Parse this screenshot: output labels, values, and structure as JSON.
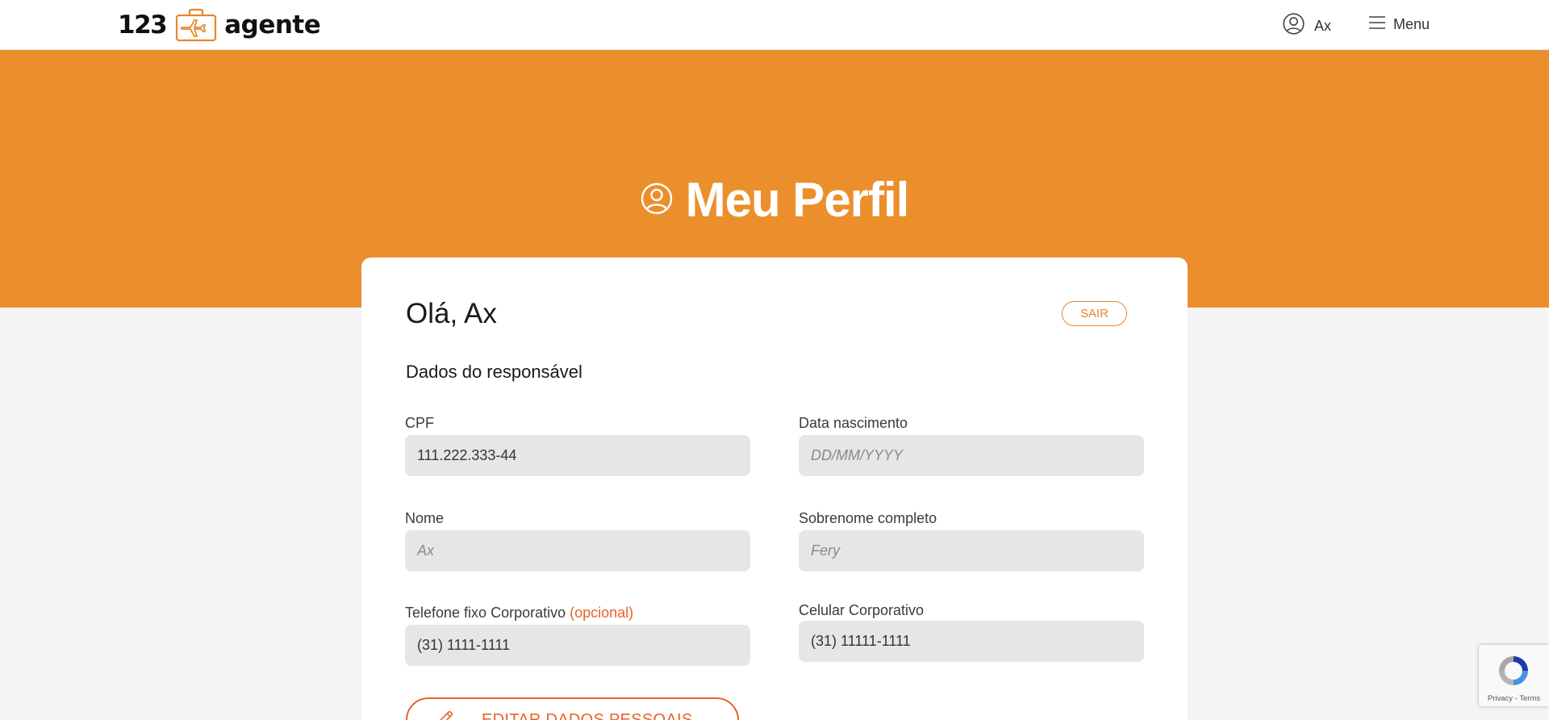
{
  "header": {
    "logo": {
      "number": "123",
      "word": "agente"
    },
    "user_name": "Ax",
    "menu_label": "Menu"
  },
  "banner": {
    "title": "Meu Perfil",
    "background_color": "#eb8f2c"
  },
  "profile": {
    "greeting": "Olá, Ax",
    "logout_label": "SAIR",
    "section_title": "Dados do responsável",
    "fields": {
      "cpf": {
        "label": "CPF",
        "value": "111.222.333-44",
        "placeholder": ""
      },
      "birth_date": {
        "label": "Data nascimento",
        "value": "",
        "placeholder": "DD/MM/YYYY"
      },
      "first_name": {
        "label": "Nome",
        "value": "",
        "placeholder": "Ax"
      },
      "last_name": {
        "label": "Sobrenome completo",
        "value": "",
        "placeholder": "Fery"
      },
      "landline": {
        "label": "Telefone fixo Corporativo",
        "optional_tag": "(opcional)",
        "value": "(31) 1111-1111",
        "placeholder": ""
      },
      "mobile": {
        "label": "Celular Corporativo",
        "value": "(31) 11111-1111",
        "placeholder": ""
      }
    },
    "edit_button_label": "EDITAR DADOS PESSOAIS",
    "edit_icon": "pencil-icon"
  },
  "recaptcha": {
    "links": "Privacy - Terms"
  },
  "colors": {
    "accent_orange": "#eb8f2c",
    "action_orange": "#e8622a",
    "input_bg": "#e6e6e6"
  }
}
